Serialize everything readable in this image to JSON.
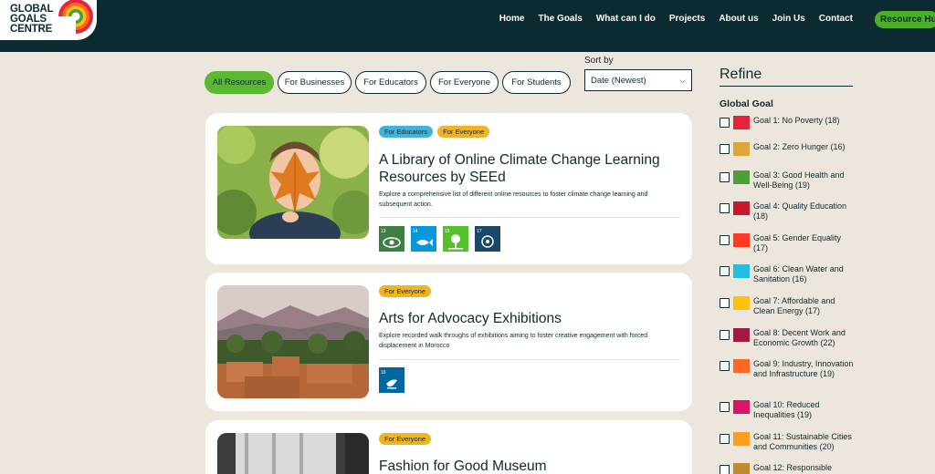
{
  "logo": {
    "line1": "GLOBAL",
    "line2": "GOALS",
    "line3": "CENTRE"
  },
  "nav": {
    "items": [
      "Home",
      "The Goals",
      "What can I do",
      "Projects",
      "About us",
      "Join Us",
      "Contact"
    ],
    "cta": "Resource Hub"
  },
  "filters": {
    "chips": [
      "All Resources",
      "For Businesses",
      "For Educators",
      "For Everyone",
      "For Students"
    ],
    "active": "All Resources"
  },
  "sort": {
    "label": "Sort by",
    "value": "Date (Newest)"
  },
  "cards": [
    {
      "tags": [
        "For Educators",
        "For Everyone"
      ],
      "title": "A Library of Online Climate Change Learning Resources by SEEd",
      "description": "Explore a comprehensive list of different online resources to foster climate change learning and subsequent action.",
      "goals": [
        {
          "num": "13",
          "name": "CLIMATE ACTION",
          "color": "#3f7e44",
          "icon": "eye-icon"
        },
        {
          "num": "14",
          "name": "LIFE BELOW WATER",
          "color": "#0a97d9",
          "icon": "fish-icon"
        },
        {
          "num": "15",
          "name": "LIFE ON LAND",
          "color": "#56c02b",
          "icon": "tree-icon"
        },
        {
          "num": "17",
          "name": "PARTNERSHIPS FOR THE GOALS",
          "color": "#19486a",
          "icon": "flower-icon"
        }
      ]
    },
    {
      "tags": [
        "For Everyone"
      ],
      "title": "Arts for Advocacy Exhibitions",
      "description": "Explore recorded walk throughs of exhibitions aiming to foster creative engagement with forced displacement in Morocco",
      "goals": [
        {
          "num": "16",
          "name": "PEACE, JUSTICE AND STRONG INSTITUTIONS",
          "color": "#00689d",
          "icon": "dove-icon"
        }
      ]
    },
    {
      "tags": [
        "For Everyone"
      ],
      "title": "Fashion for Good Museum",
      "description": "",
      "goals": []
    }
  ],
  "refine": {
    "title": "Refine",
    "section": "Global Goal",
    "items": [
      {
        "label": "Goal 1: No Poverty (18)",
        "color": "#e5243b"
      },
      {
        "label": "Goal 2: Zero Hunger (16)",
        "color": "#dda63a"
      },
      {
        "label": "Goal 3: Good Health and Well-Being (19)",
        "color": "#4c9f38"
      },
      {
        "label": "Goal 4: Quality Education (18)",
        "color": "#c5192d"
      },
      {
        "label": "Goal 5: Gender Equality (17)",
        "color": "#ff3a21"
      },
      {
        "label": "Goal 6: Clean Water and Sanitation (16)",
        "color": "#26bde2"
      },
      {
        "label": "Goal 7: Affordable and Clean Energy (17)",
        "color": "#fcc30b"
      },
      {
        "label": "Goal 8: Decent Work and Economic Growth (22)",
        "color": "#a21942"
      },
      {
        "label": "Goal 9: Industry, Innovation and Infrastructure (19)",
        "color": "#fd6925"
      },
      {
        "label": "Goal 10: Reduced Inequalities (19)",
        "color": "#dd1367"
      },
      {
        "label": "Goal 11: Sustainable Cities and Communities (20)",
        "color": "#fd9d24"
      },
      {
        "label": "Goal 12: Responsible",
        "color": "#bf8b2e"
      }
    ]
  }
}
